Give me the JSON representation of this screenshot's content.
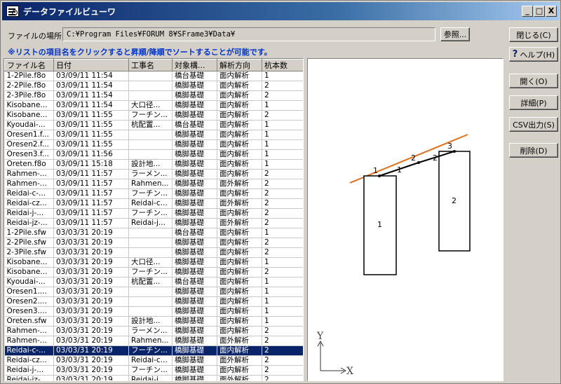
{
  "window": {
    "title": "データファイルビューワ",
    "min": "_",
    "max": "□",
    "close": "X"
  },
  "location": {
    "label": "ファイルの場所",
    "path": "C:¥Program Files¥FORUM 8¥SFrame3¥Data¥",
    "browse": "参照..."
  },
  "note": "※リストの項目名をクリックすると昇順/降順でソートすることが可能です。",
  "columns": [
    "ファイル名",
    "日付",
    "工事名",
    "対象構...",
    "解析方向",
    "杭本数"
  ],
  "rows": [
    [
      "1-2Pile.f8o",
      "03/09/11 11:54",
      "",
      "橋台基礎",
      "面内解析",
      "1"
    ],
    [
      "2-2Pile.f8o",
      "03/09/11 11:54",
      "",
      "橋脚基礎",
      "面内解析",
      "2"
    ],
    [
      "2-3Pile.f8o",
      "03/09/11 11:54",
      "",
      "橋脚基礎",
      "面内解析",
      "2"
    ],
    [
      "Kisobane...",
      "03/09/11 11:54",
      "大口径...",
      "橋脚基礎",
      "面内解析",
      "1"
    ],
    [
      "Kisobane...",
      "03/09/11 11:55",
      "フーチン...",
      "橋脚基礎",
      "面内解析",
      "2"
    ],
    [
      "Kyoudai-...",
      "03/09/11 11:55",
      "杭配置...",
      "橋台基礎",
      "面内解析",
      "1"
    ],
    [
      "Oresen1.f...",
      "03/09/11 11:55",
      "",
      "橋脚基礎",
      "面内解析",
      "1"
    ],
    [
      "Oresen2.f...",
      "03/09/11 11:55",
      "",
      "橋脚基礎",
      "面内解析",
      "1"
    ],
    [
      "Oresen3.f...",
      "03/09/11 11:56",
      "",
      "橋脚基礎",
      "面内解析",
      "1"
    ],
    [
      "Oreten.f8o",
      "03/09/11 15:18",
      "設計地...",
      "橋脚基礎",
      "面内解析",
      "1"
    ],
    [
      "Rahmen-...",
      "03/09/11 11:57",
      "ラーメン...",
      "橋脚基礎",
      "面内解析",
      "2"
    ],
    [
      "Rahmen-...",
      "03/09/11 11:57",
      "Rahmen...",
      "橋脚基礎",
      "面外解析",
      "2"
    ],
    [
      "Reidai-c-...",
      "03/09/11 11:57",
      "フーチン...",
      "橋脚基礎",
      "面内解析",
      "2"
    ],
    [
      "Reidai-cz...",
      "03/09/11 11:57",
      "Reidai-c...",
      "橋脚基礎",
      "面外解析",
      "2"
    ],
    [
      "Reidai-j-...",
      "03/09/11 11:57",
      "フーチン...",
      "橋脚基礎",
      "面内解析",
      "2"
    ],
    [
      "Reidai-jz-...",
      "03/09/11 11:57",
      "Reidai-j...",
      "橋脚基礎",
      "面外解析",
      "2"
    ],
    [
      "1-2Pile.sfw",
      "03/03/31 20:19",
      "",
      "橋台基礎",
      "面内解析",
      "1"
    ],
    [
      "2-2Pile.sfw",
      "03/03/31 20:19",
      "",
      "橋脚基礎",
      "面内解析",
      "2"
    ],
    [
      "2-3Pile.sfw",
      "03/03/31 20:19",
      "",
      "橋脚基礎",
      "面内解析",
      "2"
    ],
    [
      "Kisobane...",
      "03/03/31 20:19",
      "大口径...",
      "橋脚基礎",
      "面内解析",
      "1"
    ],
    [
      "Kisobane...",
      "03/03/31 20:19",
      "フーチン...",
      "橋脚基礎",
      "面内解析",
      "2"
    ],
    [
      "Kyoudai-...",
      "03/03/31 20:19",
      "杭配置...",
      "橋台基礎",
      "面内解析",
      "1"
    ],
    [
      "Oresen1....",
      "03/03/31 20:19",
      "",
      "橋脚基礎",
      "面内解析",
      "1"
    ],
    [
      "Oresen2....",
      "03/03/31 20:19",
      "",
      "橋脚基礎",
      "面内解析",
      "1"
    ],
    [
      "Oresen3....",
      "03/03/31 20:19",
      "",
      "橋脚基礎",
      "面内解析",
      "1"
    ],
    [
      "Oreten.sfw",
      "03/03/31 20:19",
      "設計地...",
      "橋脚基礎",
      "面内解析",
      "1"
    ],
    [
      "Rahmen-...",
      "03/03/31 20:19",
      "ラーメン...",
      "橋脚基礎",
      "面内解析",
      "2"
    ],
    [
      "Rahmen-...",
      "03/03/31 20:19",
      "Rahmen...",
      "橋脚基礎",
      "面外解析",
      "2"
    ],
    [
      "Reidai-c-...",
      "03/03/31 20:19",
      "フーチン...",
      "橋脚基礎",
      "面内解析",
      "2"
    ],
    [
      "Reidai-cz...",
      "03/03/31 20:19",
      "Reidai-c...",
      "橋脚基礎",
      "面外解析",
      "2"
    ],
    [
      "Reidai-j-...",
      "03/03/31 20:19",
      "フーチン...",
      "橋脚基礎",
      "面内解析",
      "2"
    ],
    [
      "Reidai-jz-...",
      "03/03/31 20:19",
      "Reidai-j...",
      "橋脚基礎",
      "面外解析",
      "2"
    ]
  ],
  "selected_row": 28,
  "preview": {
    "pier_labels": [
      "1",
      "2"
    ],
    "node_labels": [
      "1",
      "2",
      "3"
    ],
    "member_labels": [
      "1",
      "2"
    ],
    "axis_y": "Y",
    "axis_x": "X",
    "ground_line_color": "#e07020"
  },
  "buttons": {
    "close": "閉じる(C)",
    "help": "ヘルプ(H)",
    "open": "開く(O)",
    "detail": "詳細(P)",
    "csv": "CSV出力(S)",
    "delete": "削除(D)"
  }
}
